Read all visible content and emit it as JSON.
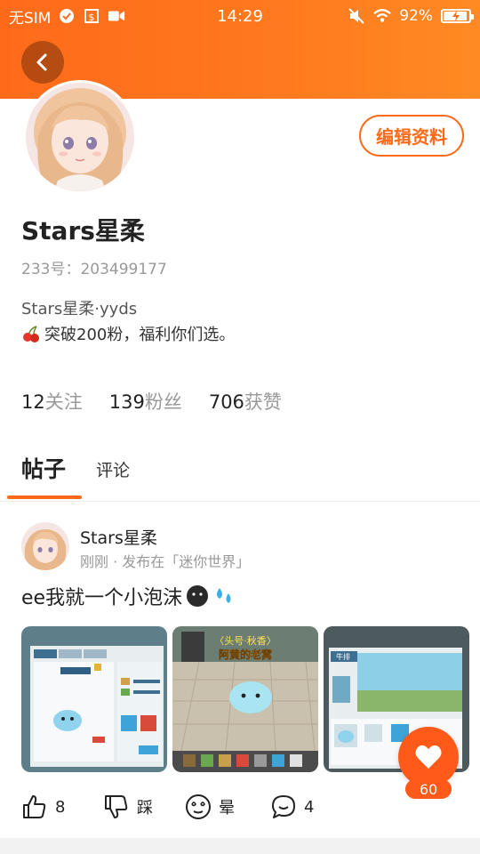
{
  "status_bar": {
    "carrier": "无SIM",
    "time": "14:29",
    "battery": "92%",
    "battery_level": 0.92
  },
  "header": {
    "edit_label": "编辑资料"
  },
  "profile": {
    "name": "Stars星柔",
    "uid": "233号：203499177",
    "bio_line1": "Stars星柔·yyds",
    "bio_line2": "突破200粉，福利你们选。",
    "stats": [
      {
        "num": "12",
        "label": "关注"
      },
      {
        "num": "139",
        "label": "粉丝"
      },
      {
        "num": "706",
        "label": "获赞"
      }
    ]
  },
  "tabs": {
    "posts": "帖子",
    "comments": "评论"
  },
  "post": {
    "author": "Stars星柔",
    "meta": "刚刚 · 发布在「迷你世界」",
    "text": "ee我就一个小泡沫",
    "thumbnails": {
      "t2_banner": "〈头号·秋香〉",
      "t2_title": "阿黄的老窝",
      "t3_header": "牛排"
    },
    "like_count": "60",
    "actions": {
      "upvote": "8",
      "downvote": "踩",
      "dizzy": "晕",
      "comments": "4"
    }
  },
  "colors": {
    "accent": "#ff6a1a",
    "fab": "#ff5a1a"
  }
}
